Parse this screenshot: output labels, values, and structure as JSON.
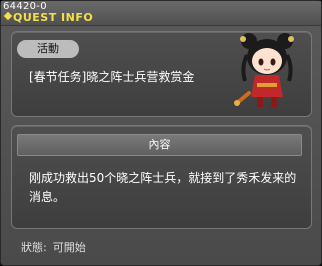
{
  "window": {
    "id": "64420-0",
    "title": "QUEST INFO"
  },
  "quest": {
    "category_tag": "活動",
    "name": "[春节任务]晓之阵士兵营救赏金"
  },
  "content": {
    "header": "內容",
    "text": "刚成功救出50个晓之阵士兵，就接到了秀禾发来的消息。"
  },
  "status": {
    "label": "狀態:",
    "value": "可開始"
  },
  "colors": {
    "title_yellow": "#f5e04a",
    "tag_bg": "#bcbcbc"
  }
}
